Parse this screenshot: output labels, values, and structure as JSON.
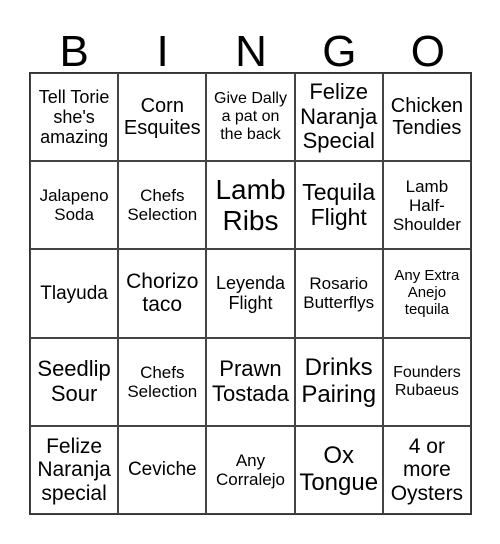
{
  "header": {
    "letters": [
      "B",
      "I",
      "N",
      "G",
      "O"
    ]
  },
  "cells": [
    "Tell Torie\nshe's\namazing",
    "Corn\nEsquites",
    "Give Dally\na pat on\nthe back",
    "Felize\nNaranja\nSpecial",
    "Chicken\nTendies",
    "Jalapeno\nSoda",
    "Chefs\nSelection",
    "Lamb\nRibs",
    "Tequila\nFlight",
    "Lamb\nHalf-\nShoulder",
    "Tlayuda",
    "Chorizo\ntaco",
    "Leyenda\nFlight",
    "Rosario\nButterflys",
    "Any Extra\nAnejo\ntequila",
    "Seedlip\nSour",
    "Chefs\nSelection",
    "Prawn\nTostada",
    "Drinks\nPairing",
    "Founders\nRubaeus",
    "Felize\nNaranja\nspecial",
    "Ceviche",
    "Any\nCorralejo",
    "Ox\nTongue",
    "4 or\nmore\nOysters"
  ]
}
